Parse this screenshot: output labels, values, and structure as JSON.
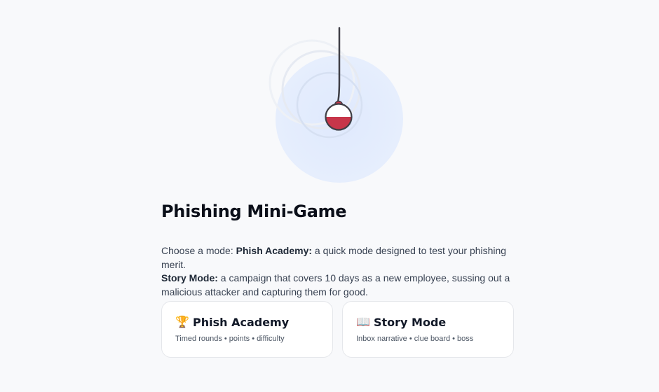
{
  "game": {
    "title": "Phishing Mini-Game",
    "intro_prefix": "Choose a mode: ",
    "academy_name": "Phish Academy:",
    "academy_desc": " a quick mode designed to test your phishing merit.",
    "story_name": "Story Mode:",
    "story_desc": " a campaign that covers 10 days as a new employee, sussing out a malicious attacker and capturing them for good."
  },
  "modes": [
    {
      "icon": "trophy-icon",
      "glyph": "🏆",
      "label": "Phish Academy",
      "subtitle": "Timed rounds • points • difficulty"
    },
    {
      "icon": "open-book-icon",
      "glyph": "📖",
      "label": "Story Mode",
      "subtitle": "Inbox narrative • clue board • boss"
    }
  ],
  "colors": {
    "bobber_red": "#c7364a",
    "bubble_blue": "#dbe7fd",
    "line": "#3f3f46"
  }
}
